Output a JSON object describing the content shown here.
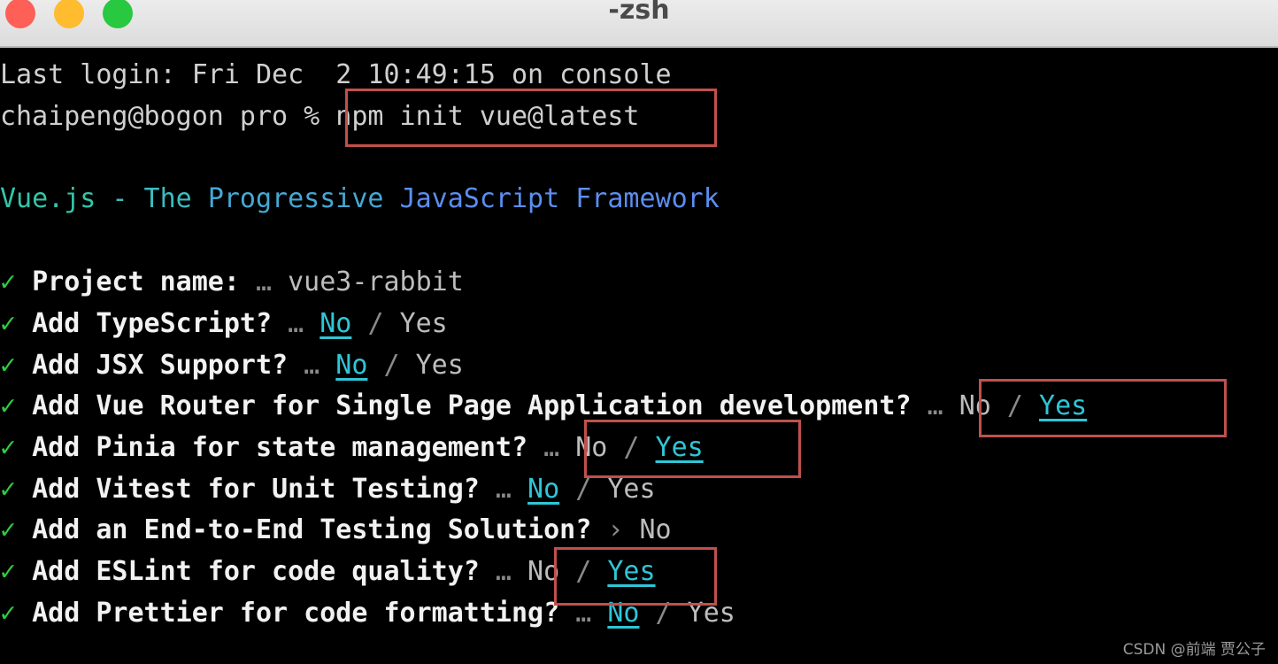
{
  "window": {
    "title": "-zsh"
  },
  "terminal": {
    "last_login": "Last login: Fri Dec  2 10:49:15 on console",
    "prompt": "chaipeng@bogon pro % ",
    "command": "npm init vue@latest",
    "banner": {
      "part1": "Vue.js",
      "part2": " - The ",
      "part3": "Progressive ",
      "part4": "JavaScript Framework"
    },
    "check_mark": "✓",
    "ellipsis": "…",
    "arrow": "›",
    "slash": "/",
    "q_project": {
      "label": "Project name:",
      "value": "vue3-rabbit"
    },
    "q_typescript": {
      "label": "Add TypeScript?",
      "no": "No",
      "yes": "Yes"
    },
    "q_jsx": {
      "label": "Add JSX Support?",
      "no": "No",
      "yes": "Yes"
    },
    "q_router": {
      "label": "Add Vue Router for Single Page Application development?",
      "no": "No",
      "yes": "Yes"
    },
    "q_pinia": {
      "label": "Add Pinia for state management?",
      "no": "No",
      "yes": "Yes"
    },
    "q_vitest": {
      "label": "Add Vitest for Unit Testing?",
      "no": "No",
      "yes": "Yes"
    },
    "q_e2e": {
      "label": "Add an End-to-End Testing Solution?",
      "value": "No"
    },
    "q_eslint": {
      "label": "Add ESLint for code quality?",
      "no": "No",
      "yes": "Yes"
    },
    "q_prettier": {
      "label": "Add Prettier for code formatting?",
      "no": "No",
      "yes": "Yes"
    }
  },
  "watermark": "CSDN @前端 贾公子",
  "colors": {
    "highlight_box": "#c0504d",
    "selected_option": "#2fc6d6",
    "check": "#2ecc40"
  }
}
